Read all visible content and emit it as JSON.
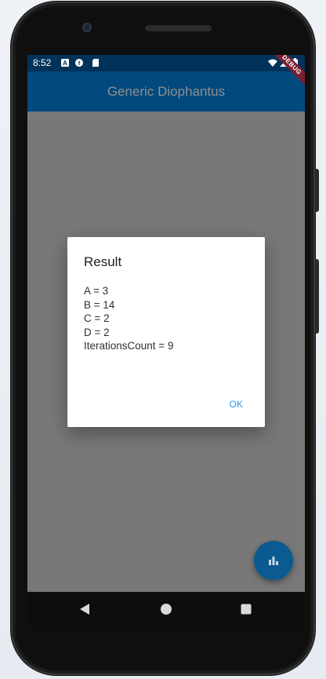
{
  "status_bar": {
    "time": "8:52",
    "icons": [
      "notification-a-icon",
      "notification-f-icon",
      "sd-card-icon",
      "wifi-icon",
      "signal-icon",
      "battery-icon"
    ],
    "debug_label": "DEBUG"
  },
  "app_bar": {
    "title": "Generic Diophantus"
  },
  "dialog": {
    "title": "Result",
    "lines": [
      "A = 3",
      "B = 14",
      "C = 2",
      "D = 2",
      "IterationsCount = 9"
    ],
    "ok_label": "OK"
  },
  "fab": {
    "icon": "bar-chart-icon"
  },
  "navigation": {
    "buttons": [
      "back-icon",
      "home-icon",
      "recents-icon"
    ]
  },
  "colors": {
    "status_bar": "#00325a",
    "app_bar": "#02497d",
    "scrim": "#787878",
    "accent": "#2196f3",
    "fab": "#0b5a91",
    "debug_banner": "#7a1f30"
  }
}
